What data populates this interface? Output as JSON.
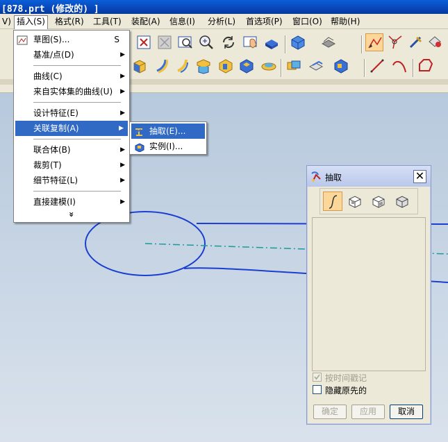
{
  "window": {
    "title": "[878.prt  (修改的)  ]"
  },
  "menubar": {
    "items": [
      {
        "label": "V)"
      },
      {
        "label": "插入(S)"
      },
      {
        "label": "格式(R)"
      },
      {
        "label": "工具(T)"
      },
      {
        "label": "装配(A)"
      },
      {
        "label": "信息(I)"
      },
      {
        "label": "分析(L)"
      },
      {
        "label": "首选项(P)"
      },
      {
        "label": "窗口(O)"
      },
      {
        "label": "帮助(H)"
      }
    ]
  },
  "insert_menu": {
    "items": [
      {
        "label": "草图(S)...",
        "shortcut": "S"
      },
      {
        "label": "基准/点(D)"
      },
      {
        "label": "曲线(C)"
      },
      {
        "label": "来自实体集的曲线(U)"
      },
      {
        "label": "设计特征(E)"
      },
      {
        "label": "关联复制(A)"
      },
      {
        "label": "联合体(B)"
      },
      {
        "label": "裁剪(T)"
      },
      {
        "label": "细节特征(L)"
      },
      {
        "label": "直接建模(I)"
      }
    ],
    "expand_glyph": "»"
  },
  "submenu": {
    "items": [
      {
        "label": "抽取(E)..."
      },
      {
        "label": "实例(I)..."
      }
    ]
  },
  "dialog": {
    "title": "抽取",
    "close_glyph": "✕",
    "checkbox_timestamp": {
      "label": "按时间戳记",
      "checked": true,
      "enabled": false
    },
    "checkbox_hide_original": {
      "label": "隐藏原先的",
      "checked": false,
      "enabled": true
    },
    "buttons": {
      "ok": "确定",
      "apply": "应用",
      "cancel": "取消"
    }
  },
  "colors": {
    "highlight": "#316ac5",
    "title_blue": "#0846b8",
    "geometry": "#1a3fd0",
    "centerline": "#1a9a9a"
  }
}
